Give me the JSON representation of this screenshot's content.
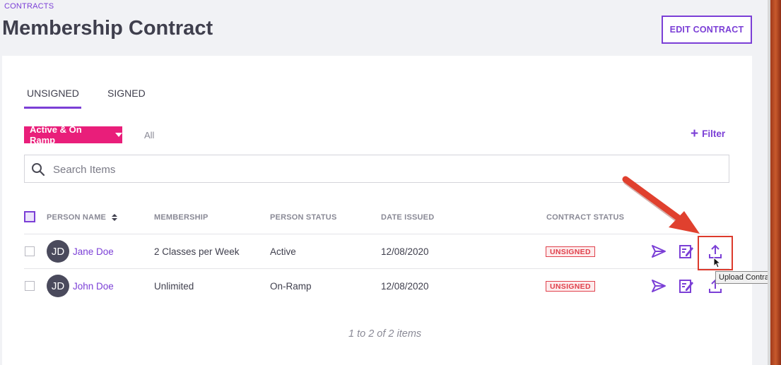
{
  "breadcrumb": "CONTRACTS",
  "page_title": "Membership Contract",
  "edit_button": "EDIT CONTRACT",
  "tabs": [
    {
      "label": "UNSIGNED",
      "active": true
    },
    {
      "label": "SIGNED",
      "active": false
    }
  ],
  "filters": {
    "status_dropdown": "Active & On Ramp",
    "all_option": "All",
    "filter_button": "Filter"
  },
  "search": {
    "placeholder": "Search Items",
    "value": ""
  },
  "table": {
    "columns": [
      "PERSON NAME",
      "MEMBERSHIP",
      "PERSON STATUS",
      "DATE ISSUED",
      "CONTRACT STATUS"
    ],
    "rows": [
      {
        "initials": "JD",
        "name": "Jane Doe",
        "membership": "2 Classes per Week",
        "status": "Active",
        "date": "12/08/2020",
        "contract_status": "UNSIGNED"
      },
      {
        "initials": "JD",
        "name": "John Doe",
        "membership": "Unlimited",
        "status": "On-Ramp",
        "date": "12/08/2020",
        "contract_status": "UNSIGNED"
      }
    ],
    "row_actions": [
      "send-icon",
      "edit-document-icon",
      "upload-icon"
    ]
  },
  "tooltip": "Upload Contract",
  "pagination": "1 to 2 of 2 items",
  "colors": {
    "accent": "#7b3fd6",
    "dropdown": "#e91e7a",
    "unsigned_badge": "#e0414c",
    "annotation": "#dc3a2c"
  }
}
